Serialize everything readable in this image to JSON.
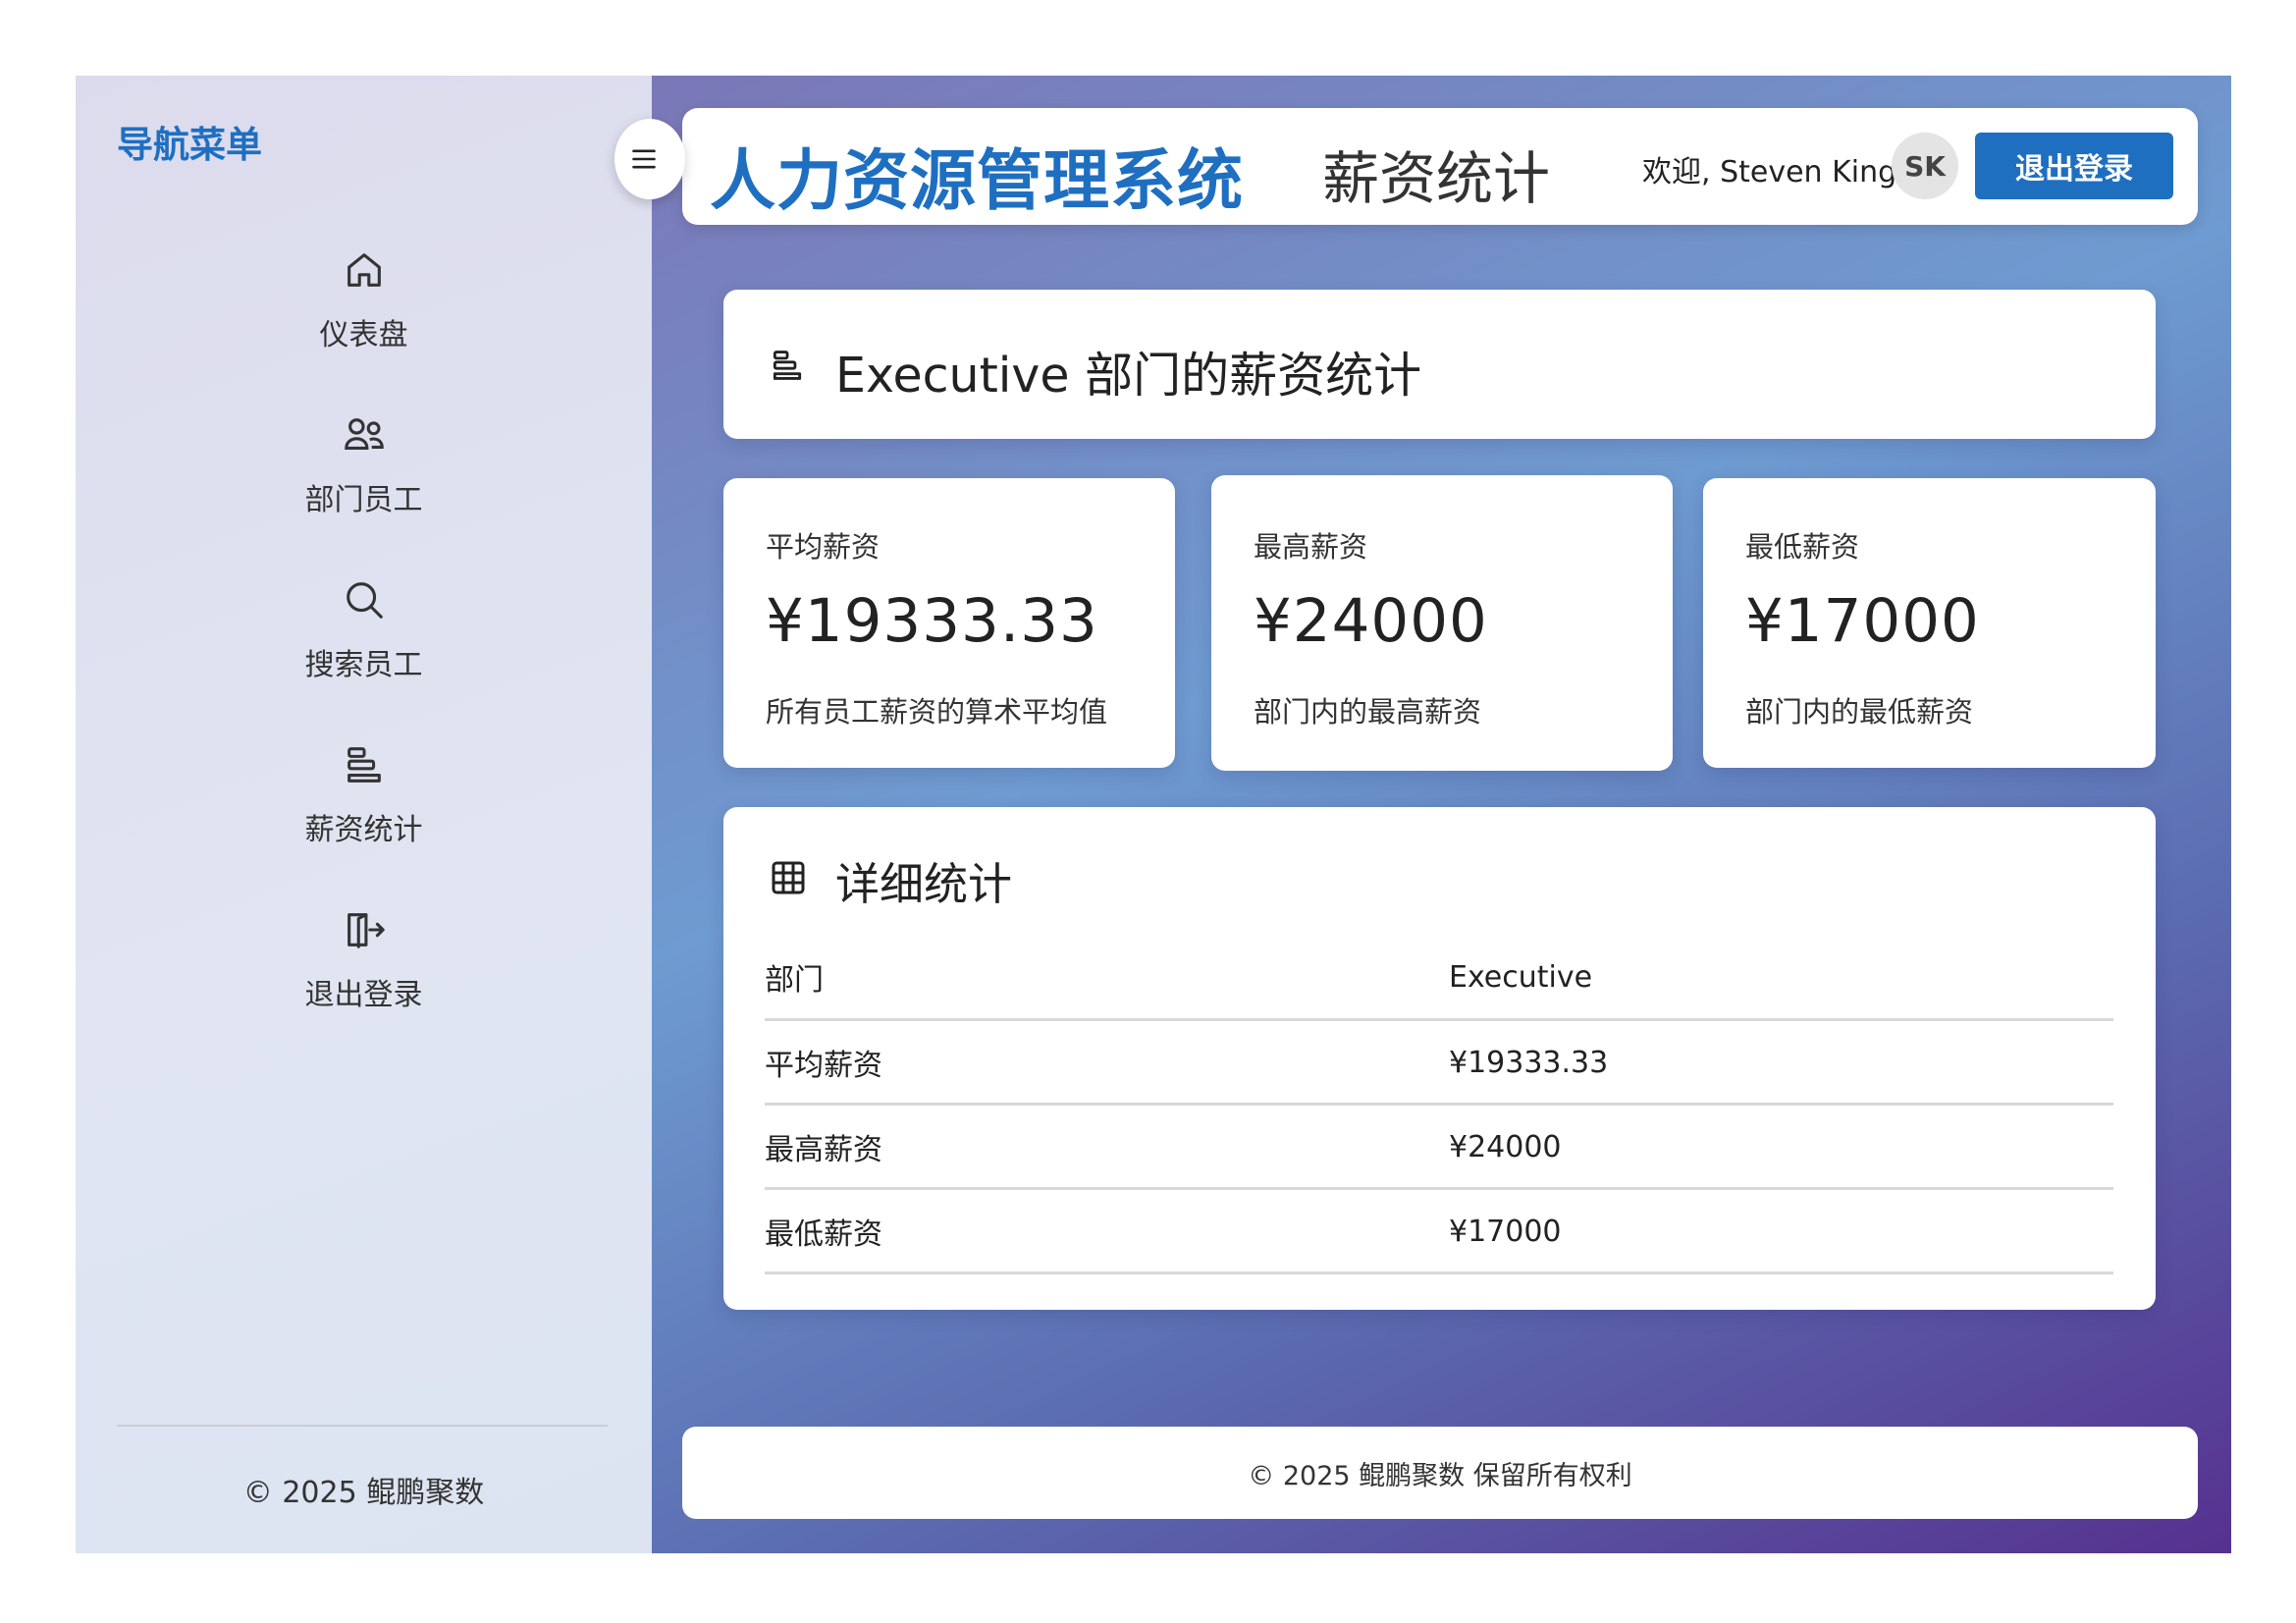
{
  "sidebar": {
    "title": "导航菜单",
    "items": [
      {
        "label": "仪表盘",
        "icon": "home-icon"
      },
      {
        "label": "部门员工",
        "icon": "users-icon"
      },
      {
        "label": "搜索员工",
        "icon": "search-icon"
      },
      {
        "label": "薪资统计",
        "icon": "bars-icon"
      },
      {
        "label": "退出登录",
        "icon": "logout-icon"
      }
    ],
    "footer": "© 2025 鲲鹏聚数"
  },
  "header": {
    "app_title": "人力资源管理系统",
    "page_title": "薪资统计",
    "welcome": "欢迎, Steven King",
    "avatar_initials": "SK",
    "logout_label": "退出登录"
  },
  "department": {
    "title": "Executive 部门的薪资统计"
  },
  "stats": [
    {
      "label": "平均薪资",
      "value": "¥19333.33",
      "desc": "所有员工薪资的算术平均值"
    },
    {
      "label": "最高薪资",
      "value": "¥24000",
      "desc": "部门内的最高薪资"
    },
    {
      "label": "最低薪资",
      "value": "¥17000",
      "desc": "部门内的最低薪资"
    }
  ],
  "detail": {
    "title": "详细统计",
    "rows": [
      [
        "部门",
        "Executive"
      ],
      [
        "平均薪资",
        "¥19333.33"
      ],
      [
        "最高薪资",
        "¥24000"
      ],
      [
        "最低薪资",
        "¥17000"
      ]
    ]
  },
  "footer": {
    "text": "© 2025 鲲鹏聚数 保留所有权利"
  },
  "colors": {
    "accent": "#1f6fc1"
  }
}
